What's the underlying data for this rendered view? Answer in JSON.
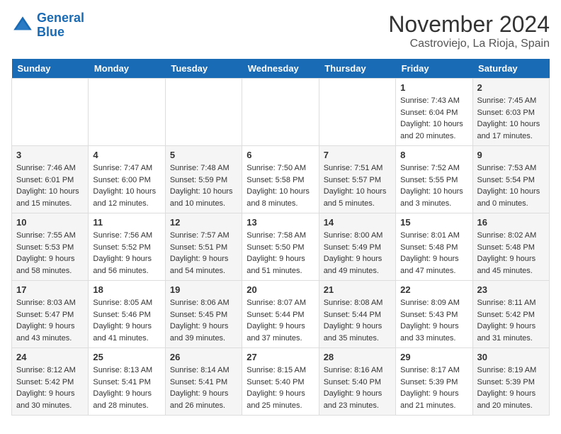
{
  "logo": {
    "line1": "General",
    "line2": "Blue"
  },
  "title": "November 2024",
  "location": "Castroviejo, La Rioja, Spain",
  "days_of_week": [
    "Sunday",
    "Monday",
    "Tuesday",
    "Wednesday",
    "Thursday",
    "Friday",
    "Saturday"
  ],
  "weeks": [
    [
      {
        "day": "",
        "info": ""
      },
      {
        "day": "",
        "info": ""
      },
      {
        "day": "",
        "info": ""
      },
      {
        "day": "",
        "info": ""
      },
      {
        "day": "",
        "info": ""
      },
      {
        "day": "1",
        "info": "Sunrise: 7:43 AM\nSunset: 6:04 PM\nDaylight: 10 hours and 20 minutes."
      },
      {
        "day": "2",
        "info": "Sunrise: 7:45 AM\nSunset: 6:03 PM\nDaylight: 10 hours and 17 minutes."
      }
    ],
    [
      {
        "day": "3",
        "info": "Sunrise: 7:46 AM\nSunset: 6:01 PM\nDaylight: 10 hours and 15 minutes."
      },
      {
        "day": "4",
        "info": "Sunrise: 7:47 AM\nSunset: 6:00 PM\nDaylight: 10 hours and 12 minutes."
      },
      {
        "day": "5",
        "info": "Sunrise: 7:48 AM\nSunset: 5:59 PM\nDaylight: 10 hours and 10 minutes."
      },
      {
        "day": "6",
        "info": "Sunrise: 7:50 AM\nSunset: 5:58 PM\nDaylight: 10 hours and 8 minutes."
      },
      {
        "day": "7",
        "info": "Sunrise: 7:51 AM\nSunset: 5:57 PM\nDaylight: 10 hours and 5 minutes."
      },
      {
        "day": "8",
        "info": "Sunrise: 7:52 AM\nSunset: 5:55 PM\nDaylight: 10 hours and 3 minutes."
      },
      {
        "day": "9",
        "info": "Sunrise: 7:53 AM\nSunset: 5:54 PM\nDaylight: 10 hours and 0 minutes."
      }
    ],
    [
      {
        "day": "10",
        "info": "Sunrise: 7:55 AM\nSunset: 5:53 PM\nDaylight: 9 hours and 58 minutes."
      },
      {
        "day": "11",
        "info": "Sunrise: 7:56 AM\nSunset: 5:52 PM\nDaylight: 9 hours and 56 minutes."
      },
      {
        "day": "12",
        "info": "Sunrise: 7:57 AM\nSunset: 5:51 PM\nDaylight: 9 hours and 54 minutes."
      },
      {
        "day": "13",
        "info": "Sunrise: 7:58 AM\nSunset: 5:50 PM\nDaylight: 9 hours and 51 minutes."
      },
      {
        "day": "14",
        "info": "Sunrise: 8:00 AM\nSunset: 5:49 PM\nDaylight: 9 hours and 49 minutes."
      },
      {
        "day": "15",
        "info": "Sunrise: 8:01 AM\nSunset: 5:48 PM\nDaylight: 9 hours and 47 minutes."
      },
      {
        "day": "16",
        "info": "Sunrise: 8:02 AM\nSunset: 5:48 PM\nDaylight: 9 hours and 45 minutes."
      }
    ],
    [
      {
        "day": "17",
        "info": "Sunrise: 8:03 AM\nSunset: 5:47 PM\nDaylight: 9 hours and 43 minutes."
      },
      {
        "day": "18",
        "info": "Sunrise: 8:05 AM\nSunset: 5:46 PM\nDaylight: 9 hours and 41 minutes."
      },
      {
        "day": "19",
        "info": "Sunrise: 8:06 AM\nSunset: 5:45 PM\nDaylight: 9 hours and 39 minutes."
      },
      {
        "day": "20",
        "info": "Sunrise: 8:07 AM\nSunset: 5:44 PM\nDaylight: 9 hours and 37 minutes."
      },
      {
        "day": "21",
        "info": "Sunrise: 8:08 AM\nSunset: 5:44 PM\nDaylight: 9 hours and 35 minutes."
      },
      {
        "day": "22",
        "info": "Sunrise: 8:09 AM\nSunset: 5:43 PM\nDaylight: 9 hours and 33 minutes."
      },
      {
        "day": "23",
        "info": "Sunrise: 8:11 AM\nSunset: 5:42 PM\nDaylight: 9 hours and 31 minutes."
      }
    ],
    [
      {
        "day": "24",
        "info": "Sunrise: 8:12 AM\nSunset: 5:42 PM\nDaylight: 9 hours and 30 minutes."
      },
      {
        "day": "25",
        "info": "Sunrise: 8:13 AM\nSunset: 5:41 PM\nDaylight: 9 hours and 28 minutes."
      },
      {
        "day": "26",
        "info": "Sunrise: 8:14 AM\nSunset: 5:41 PM\nDaylight: 9 hours and 26 minutes."
      },
      {
        "day": "27",
        "info": "Sunrise: 8:15 AM\nSunset: 5:40 PM\nDaylight: 9 hours and 25 minutes."
      },
      {
        "day": "28",
        "info": "Sunrise: 8:16 AM\nSunset: 5:40 PM\nDaylight: 9 hours and 23 minutes."
      },
      {
        "day": "29",
        "info": "Sunrise: 8:17 AM\nSunset: 5:39 PM\nDaylight: 9 hours and 21 minutes."
      },
      {
        "day": "30",
        "info": "Sunrise: 8:19 AM\nSunset: 5:39 PM\nDaylight: 9 hours and 20 minutes."
      }
    ]
  ]
}
